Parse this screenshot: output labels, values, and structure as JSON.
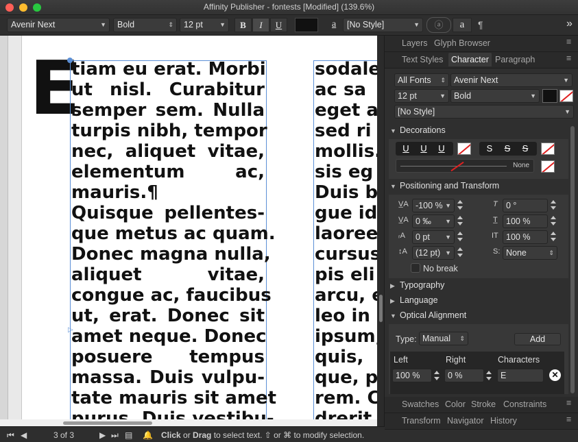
{
  "window": {
    "title": "Affinity Publisher - fontests [Modified] (139.6%)"
  },
  "toolbar": {
    "font_family": "Avenir Next",
    "font_style": "Bold",
    "font_size": "12 pt",
    "bold": "B",
    "italic": "I",
    "underline": "U",
    "style_icon": "a",
    "para_style": "[No Style]",
    "char_btn": "a",
    "pilcrow": "¶",
    "more": "»"
  },
  "document": {
    "drop_cap": "E",
    "column1": [
      "tiam eu erat. Morbi",
      "ut nisl. Curabitur",
      "semper sem. Nulla",
      "turpis nibh, tempor",
      "nec, aliquet vitae,",
      "elementum ac,",
      "mauris.¶",
      "Quisque pellentes-",
      "que metus ac quam.",
      "Donec magna nulla,",
      "aliquet vitae,",
      "congue ac, faucibus",
      "ut, erat. Donec sit",
      "amet neque. Donec",
      "posuere tempus",
      "massa. Duis vulpu-",
      "tate mauris sit amet",
      "purus. Duis vestibu-"
    ],
    "column2": [
      "sodale",
      "ac sa",
      "eget au",
      "sed ri",
      "mollis.",
      "sis eg",
      "Duis b",
      "gue id",
      "laoree",
      "cursus",
      "pis eli",
      "arcu, e",
      "leo in",
      "ipsum,",
      "quis,",
      "que, p",
      "rem. C",
      "drerit"
    ]
  },
  "statusbar": {
    "page_info": "3 of 3",
    "hint_click": "Click",
    "hint_or1": " or ",
    "hint_drag": "Drag",
    "hint_rest": " to select text. ⇧ or ⌘ to modify selection."
  },
  "panel": {
    "top_tabs": [
      "Layers",
      "Glyph Browser"
    ],
    "char_tabs": [
      "Text Styles",
      "Character",
      "Paragraph"
    ],
    "font_collection": "All Fonts",
    "font_family": "Avenir Next",
    "font_size": "12 pt",
    "font_style": "Bold",
    "char_style": "[No Style]",
    "decorations": {
      "title": "Decorations",
      "underline_btns": [
        "U",
        "U",
        "U"
      ],
      "strike_btns": [
        "S",
        "S",
        "S"
      ],
      "line_label": "None"
    },
    "positioning": {
      "title": "Positioning and Transform",
      "tracking": "-100 %",
      "kerning": "0 ‰",
      "baseline": "0 pt",
      "leading": "(12 pt)",
      "shear": "0 °",
      "vscale": "100 %",
      "hscale": "100 %",
      "typography_style": "None",
      "no_break": "No break"
    },
    "typography": "Typography",
    "language": "Language",
    "optical": {
      "title": "Optical Alignment",
      "type_label": "Type:",
      "type_value": "Manual",
      "add": "Add",
      "col_left": "Left",
      "col_right": "Right",
      "col_chars": "Characters",
      "left_val": "100 %",
      "right_val": "0 %",
      "chars_val": "E"
    },
    "bottom_tabs1": [
      "Swatches",
      "Color",
      "Stroke",
      "Constraints"
    ],
    "bottom_tabs2": [
      "Transform",
      "Navigator",
      "History"
    ]
  },
  "colors": {
    "frame_blue": "#5b8fd6",
    "close": "#ff5f57",
    "minimize": "#febc2e",
    "zoom": "#28c840",
    "accent": "#3a3a3a"
  }
}
